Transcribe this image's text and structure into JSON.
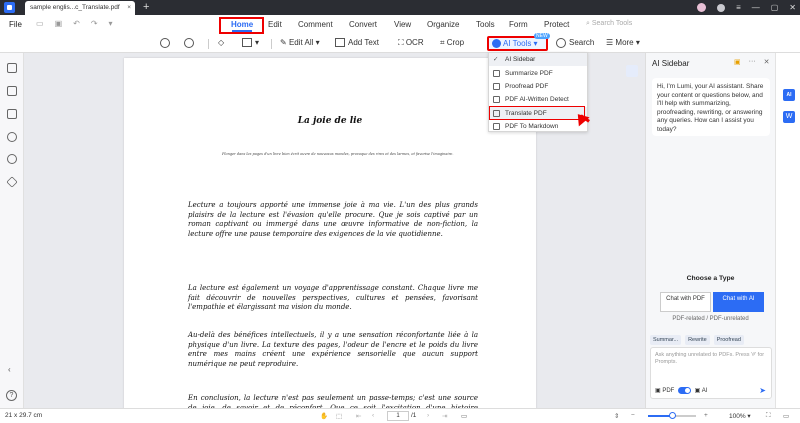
{
  "titlebar": {
    "doc_tab_label": "sample englis...c_Translate.pdf",
    "close_glyph": "×",
    "add_tab_glyph": "+"
  },
  "menubar": {
    "file_label": "File",
    "items": [
      "Home",
      "Edit",
      "Comment",
      "Convert",
      "View",
      "Organize",
      "Tools",
      "Form",
      "Protect"
    ],
    "active_item": "Home",
    "search_placeholder": "Search Tools"
  },
  "toolbar": {
    "edit_all": "Edit All",
    "add_text": "Add Text",
    "ocr": "OCR",
    "crop": "Crop",
    "ai_tools": "AI Tools",
    "new_badge": "NEW",
    "search": "Search",
    "more": "More"
  },
  "ai_tools_menu": {
    "items": [
      {
        "label": "AI Sidebar",
        "icon": "check-icon",
        "checked": true
      },
      {
        "label": "Summarize PDF",
        "icon": "summarize-icon"
      },
      {
        "label": "Proofread PDF",
        "icon": "proofread-icon"
      },
      {
        "label": "PDF AI-Written Detect",
        "icon": "ai-detect-icon"
      },
      {
        "label": "Translate PDF",
        "icon": "translate-icon"
      },
      {
        "label": "PDF To Markdown",
        "icon": "markdown-icon"
      }
    ],
    "highlighted_item": "Translate PDF"
  },
  "document": {
    "title": "La joie de lie",
    "subtitle": "Plonger dans les pages d'un livre bien écrit ouvre de nouveaux mondes, provoque des rires et des larmes, et favorise l'imaginaire.",
    "paragraphs": [
      "Lecture a toujours apporté une immense joie à ma vie. L'un des plus grands plaisirs de la lecture est l'évasion qu'elle procure. Que je sois captivé par un roman captivant ou immergé dans une œuvre informative de non-fiction, la lecture offre une pause temporaire des exigences de la vie quotidienne.",
      "La lecture est également un voyage d'apprentissage constant. Chaque livre me fait découvrir de nouvelles perspectives, cultures et pensées, favorisant l'empathie et élargissant ma vision du monde.",
      "Au-delà des bénéfices intellectuels, il y a une sensation réconfortante liée à la physique d'un livre. La texture des pages, l'odeur de l'encre et le poids du livre entre mes mains créent une expérience sensorielle que aucun support numérique ne peut reproduire.",
      "En conclusion, la lecture n'est pas seulement un passe-temps; c'est une source de joie, de savoir et de réconfort. Que ce soit l'excitation d'une histoire captivante ou la"
    ]
  },
  "ai_sidebar": {
    "title": "AI Sidebar",
    "greeting": "Hi, I'm Lumi, your AI assistant. Share your content or questions below, and I'll help with summarizing, proofreading, rewriting, or answering any queries. How can I assist you today?",
    "choose_type": "Choose a Type",
    "chat_with_pdf": "Chat with PDF",
    "chat_with_ai": "Chat with AI",
    "pdf_related": "PDF-related / PDF-unrelated",
    "chips": [
      "Summar...",
      "Rewrite",
      "Proofread"
    ],
    "input_placeholder": "Ask anything unrelated to PDFs. Press '#' for Prompts.",
    "opt_pdf": "PDF",
    "opt_ai": "AI"
  },
  "right_strip": {
    "ai_badge": "AI",
    "word_badge": "W"
  },
  "statusbar": {
    "page_size": "21 x 29.7 cm",
    "page_input": "1",
    "page_total": "/1",
    "zoom": "100%",
    "zoom_level": 0.45
  },
  "colors": {
    "accent": "#2c6cf4",
    "highlight_red": "#e00000",
    "titlebar": "#2b2d33"
  }
}
